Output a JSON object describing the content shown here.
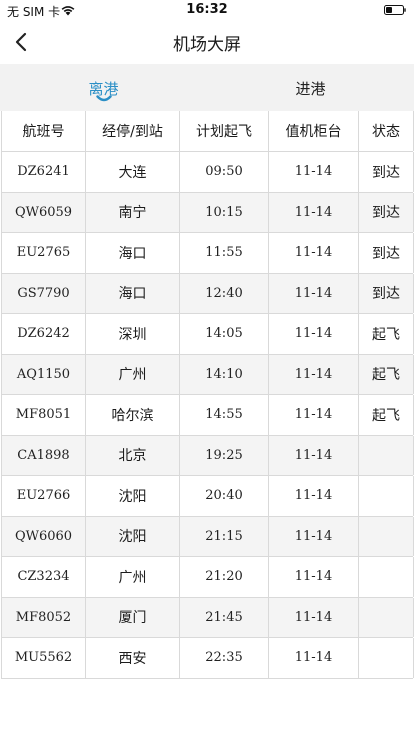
{
  "status_bar": {
    "carrier": "无 SIM 卡",
    "time": "16:32"
  },
  "nav": {
    "title": "机场大屏"
  },
  "tabs": [
    {
      "label": "离港",
      "active": true
    },
    {
      "label": "进港",
      "active": false
    }
  ],
  "table": {
    "headers": [
      "航班号",
      "经停/到站",
      "计划起飞",
      "值机柜台",
      "状态"
    ],
    "rows": [
      {
        "flight": "DZ6241",
        "stop": "大连",
        "time": "09:50",
        "counter": "11-14",
        "status": "到达"
      },
      {
        "flight": "QW6059",
        "stop": "南宁",
        "time": "10:15",
        "counter": "11-14",
        "status": "到达"
      },
      {
        "flight": "EU2765",
        "stop": "海口",
        "time": "11:55",
        "counter": "11-14",
        "status": "到达"
      },
      {
        "flight": "GS7790",
        "stop": "海口",
        "time": "12:40",
        "counter": "11-14",
        "status": "到达"
      },
      {
        "flight": "DZ6242",
        "stop": "深圳",
        "time": "14:05",
        "counter": "11-14",
        "status": "起飞"
      },
      {
        "flight": "AQ1150",
        "stop": "广州",
        "time": "14:10",
        "counter": "11-14",
        "status": "起飞"
      },
      {
        "flight": "MF8051",
        "stop": "哈尔滨",
        "time": "14:55",
        "counter": "11-14",
        "status": "起飞"
      },
      {
        "flight": "CA1898",
        "stop": "北京",
        "time": "19:25",
        "counter": "11-14",
        "status": ""
      },
      {
        "flight": "EU2766",
        "stop": "沈阳",
        "time": "20:40",
        "counter": "11-14",
        "status": ""
      },
      {
        "flight": "QW6060",
        "stop": "沈阳",
        "time": "21:15",
        "counter": "11-14",
        "status": ""
      },
      {
        "flight": "CZ3234",
        "stop": "广州",
        "time": "21:20",
        "counter": "11-14",
        "status": ""
      },
      {
        "flight": "MF8052",
        "stop": "厦门",
        "time": "21:45",
        "counter": "11-14",
        "status": ""
      },
      {
        "flight": "MU5562",
        "stop": "西安",
        "time": "22:35",
        "counter": "11-14",
        "status": ""
      }
    ]
  },
  "colors": {
    "accent": "#2b8fc6",
    "tab_bg": "#f2f2f2",
    "row_alt": "#f4f4f4",
    "grid": "#d9d9d9"
  }
}
